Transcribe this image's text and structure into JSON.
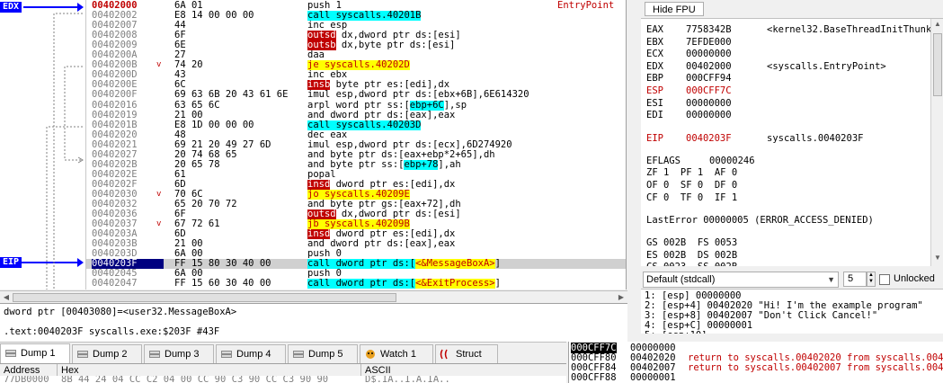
{
  "disasm": {
    "rows": [
      {
        "addr": "00402000",
        "bytes": "6A 01",
        "jmp": "",
        "ins": [
          {
            "t": "push 1",
            "c": ""
          }
        ],
        "cmt": "EntryPoint",
        "addr_red": true
      },
      {
        "addr": "00402002",
        "bytes": "E8 14 00 00 00",
        "jmp": "",
        "ins": [
          {
            "t": "call syscalls.40201B",
            "c": "call"
          }
        ],
        "cmt": ""
      },
      {
        "addr": "00402007",
        "bytes": "44",
        "jmp": "",
        "ins": [
          {
            "t": "inc esp",
            "c": ""
          }
        ],
        "cmt": ""
      },
      {
        "addr": "00402008",
        "bytes": "6F",
        "jmp": "",
        "ins": [
          {
            "t": "outsd",
            "c": "bad"
          },
          {
            "t": " dx,dword ptr ds:[esi]",
            "c": ""
          }
        ],
        "cmt": ""
      },
      {
        "addr": "00402009",
        "bytes": "6E",
        "jmp": "",
        "ins": [
          {
            "t": "outsb",
            "c": "bad"
          },
          {
            "t": " dx,byte ptr ds:[esi]",
            "c": ""
          }
        ],
        "cmt": ""
      },
      {
        "addr": "0040200A",
        "bytes": "27",
        "jmp": "",
        "ins": [
          {
            "t": "daa",
            "c": ""
          }
        ],
        "cmt": ""
      },
      {
        "addr": "0040200B",
        "bytes": "74 20",
        "jmp": "v",
        "ins": [
          {
            "t": "je syscalls.40202D",
            "c": "jcc"
          }
        ],
        "cmt": ""
      },
      {
        "addr": "0040200D",
        "bytes": "43",
        "jmp": "",
        "ins": [
          {
            "t": "inc ebx",
            "c": ""
          }
        ],
        "cmt": ""
      },
      {
        "addr": "0040200E",
        "bytes": "6C",
        "jmp": "",
        "ins": [
          {
            "t": "insb",
            "c": "bad"
          },
          {
            "t": " byte ptr es:[edi],dx",
            "c": ""
          }
        ],
        "cmt": ""
      },
      {
        "addr": "0040200F",
        "bytes": "69 63 6B 20 43 61 6E",
        "jmp": "",
        "ins": [
          {
            "t": "imul esp,dword ptr ds:[ebx+6B],6E614320",
            "c": ""
          }
        ],
        "cmt": ""
      },
      {
        "addr": "00402016",
        "bytes": "63 65 6C",
        "jmp": "",
        "ins": [
          {
            "t": "arpl word ptr ss:[",
            "c": ""
          },
          {
            "t": "ebp+6C",
            "c": "reg"
          },
          {
            "t": "],sp",
            "c": ""
          }
        ],
        "cmt": ""
      },
      {
        "addr": "00402019",
        "bytes": "21 00",
        "jmp": "",
        "ins": [
          {
            "t": "and dword ptr ds:[eax],eax",
            "c": ""
          }
        ],
        "cmt": ""
      },
      {
        "addr": "0040201B",
        "bytes": "E8 1D 00 00 00",
        "jmp": "",
        "ins": [
          {
            "t": "call syscalls.40203D",
            "c": "call"
          }
        ],
        "cmt": ""
      },
      {
        "addr": "00402020",
        "bytes": "48",
        "jmp": "",
        "ins": [
          {
            "t": "dec eax",
            "c": ""
          }
        ],
        "cmt": ""
      },
      {
        "addr": "00402021",
        "bytes": "69 21 20 49 27 6D",
        "jmp": "",
        "ins": [
          {
            "t": "imul esp,dword ptr ds:[ecx],6D274920",
            "c": ""
          }
        ],
        "cmt": ""
      },
      {
        "addr": "00402027",
        "bytes": "20 74 68 65",
        "jmp": "",
        "ins": [
          {
            "t": "and byte ptr ds:[eax+ebp*2+65],dh",
            "c": ""
          }
        ],
        "cmt": ""
      },
      {
        "addr": "0040202B",
        "bytes": "20 65 78",
        "jmp": "",
        "ins": [
          {
            "t": "and byte ptr ss:[",
            "c": ""
          },
          {
            "t": "ebp+78",
            "c": "reg"
          },
          {
            "t": "],ah",
            "c": ""
          }
        ],
        "cmt": ""
      },
      {
        "addr": "0040202E",
        "bytes": "61",
        "jmp": "",
        "ins": [
          {
            "t": "popal",
            "c": ""
          }
        ],
        "cmt": ""
      },
      {
        "addr": "0040202F",
        "bytes": "6D",
        "jmp": "",
        "ins": [
          {
            "t": "insd",
            "c": "bad"
          },
          {
            "t": " dword ptr es:[edi],dx",
            "c": ""
          }
        ],
        "cmt": ""
      },
      {
        "addr": "00402030",
        "bytes": "70 6C",
        "jmp": "v",
        "ins": [
          {
            "t": "jo syscalls.40209E",
            "c": "jcc"
          }
        ],
        "cmt": ""
      },
      {
        "addr": "00402032",
        "bytes": "65 20 70 72",
        "jmp": "",
        "ins": [
          {
            "t": "and byte ptr gs:[eax+72],dh",
            "c": ""
          }
        ],
        "cmt": ""
      },
      {
        "addr": "00402036",
        "bytes": "6F",
        "jmp": "",
        "ins": [
          {
            "t": "outsd",
            "c": "bad"
          },
          {
            "t": " dx,dword ptr ds:[esi]",
            "c": ""
          }
        ],
        "cmt": ""
      },
      {
        "addr": "00402037",
        "bytes": "67 72 61",
        "jmp": "v",
        "ins": [
          {
            "t": "jb syscalls.40209B",
            "c": "jcc"
          }
        ],
        "cmt": ""
      },
      {
        "addr": "0040203A",
        "bytes": "6D",
        "jmp": "",
        "ins": [
          {
            "t": "insd",
            "c": "bad"
          },
          {
            "t": " dword ptr es:[edi],dx",
            "c": ""
          }
        ],
        "cmt": ""
      },
      {
        "addr": "0040203B",
        "bytes": "21 00",
        "jmp": "",
        "ins": [
          {
            "t": "and dword ptr ds:[eax],eax",
            "c": ""
          }
        ],
        "cmt": ""
      },
      {
        "addr": "0040203D",
        "bytes": "6A 00",
        "jmp": "",
        "ins": [
          {
            "t": "push 0",
            "c": ""
          }
        ],
        "cmt": ""
      },
      {
        "addr": "0040203F",
        "bytes": "FF 15 80 30 40 00",
        "jmp": "",
        "ins": [
          {
            "t": "call dword ptr ds:[",
            "c": "call"
          },
          {
            "t": "<&MessageBoxA>",
            "c": "jcc"
          },
          {
            "t": "]",
            "c": ""
          }
        ],
        "cmt": "",
        "eip": true
      },
      {
        "addr": "00402045",
        "bytes": "6A 00",
        "jmp": "",
        "ins": [
          {
            "t": "push 0",
            "c": ""
          }
        ],
        "cmt": ""
      },
      {
        "addr": "00402047",
        "bytes": "FF 15 60 30 40 00",
        "jmp": "",
        "ins": [
          {
            "t": "call dword ptr ds:[",
            "c": "call"
          },
          {
            "t": "<&ExitProcess>",
            "c": "jcc"
          },
          {
            "t": "]",
            "c": ""
          }
        ],
        "cmt": ""
      }
    ],
    "reg_edx": "EDX",
    "reg_eip": "EIP"
  },
  "info": {
    "line1": "dword ptr [00403080]=<user32.MessageBoxA>",
    "line2": ".text:0040203F syscalls.exe:$203F #43F"
  },
  "tabs": [
    {
      "label": "Dump 1",
      "active": true
    },
    {
      "label": "Dump 2",
      "active": false
    },
    {
      "label": "Dump 3",
      "active": false
    },
    {
      "label": "Dump 4",
      "active": false
    },
    {
      "label": "Dump 5",
      "active": false
    },
    {
      "label": "Watch 1",
      "active": false
    },
    {
      "label": "Struct",
      "active": false
    }
  ],
  "dump": {
    "col_address": "Address",
    "col_hex": "Hex",
    "col_ascii": "ASCII",
    "row_addr": "77DB0000",
    "row_hex": "8B 44 24 04 CC C2 04 00 CC 90 C3 90 CC C3 90 90",
    "row_ascii": "D$.ÌÂ..Ì.Ã.ÌÃ.."
  },
  "fpu": {
    "hide_label": "Hide FPU"
  },
  "registers": [
    {
      "name": "EAX",
      "value": "7758342B",
      "comment": "<kernel32.BaseThreadInitThunk>",
      "red": false
    },
    {
      "name": "EBX",
      "value": "7EFDE000",
      "comment": "",
      "red": false
    },
    {
      "name": "ECX",
      "value": "00000000",
      "comment": "",
      "red": false
    },
    {
      "name": "EDX",
      "value": "00402000",
      "comment": "<syscalls.EntryPoint>",
      "red": false
    },
    {
      "name": "EBP",
      "value": "000CFF94",
      "comment": "",
      "red": false
    },
    {
      "name": "ESP",
      "value": "000CFF7C",
      "comment": "",
      "red": true
    },
    {
      "name": "ESI",
      "value": "00000000",
      "comment": "",
      "red": false
    },
    {
      "name": "EDI",
      "value": "00000000",
      "comment": "",
      "red": false
    }
  ],
  "eip": {
    "name": "EIP",
    "value": "0040203F",
    "comment": "syscalls.0040203F"
  },
  "eflags": {
    "label": "EFLAGS",
    "value": "00000246"
  },
  "flags_rows": [
    "ZF 1  PF 1  AF 0",
    "OF 0  SF 0  DF 0",
    "CF 0  TF 0  IF 1"
  ],
  "last_error": "LastError 00000005 (ERROR_ACCESS_DENIED)",
  "segments": [
    "GS 002B  FS 0053",
    "ES 002B  DS 002B",
    "CS 0023  SS 002B"
  ],
  "callconv": {
    "selected": "Default (stdcall)",
    "arg_count": "5",
    "unlocked_label": "Unlocked"
  },
  "args": [
    "1: [esp] 00000000",
    "2: [esp+4] 00402020 \"Hi! I'm the example program\"",
    "3: [esp+8] 00402007 \"Don't Click Cancel!\"",
    "4: [esp+C] 00000001",
    "5: [esp+10] ..."
  ],
  "stack": [
    {
      "addr": "000CFF7C",
      "value": "00000000",
      "comment": "",
      "sp": true
    },
    {
      "addr": "000CFF80",
      "value": "00402020",
      "comment": "return to syscalls.00402020 from syscalls.0040201B",
      "sp": false
    },
    {
      "addr": "000CFF84",
      "value": "00402007",
      "comment": "return to syscalls.00402007 from syscalls.00402002",
      "sp": false
    },
    {
      "addr": "000CFF88",
      "value": "00000001",
      "comment": "",
      "sp": false
    }
  ]
}
